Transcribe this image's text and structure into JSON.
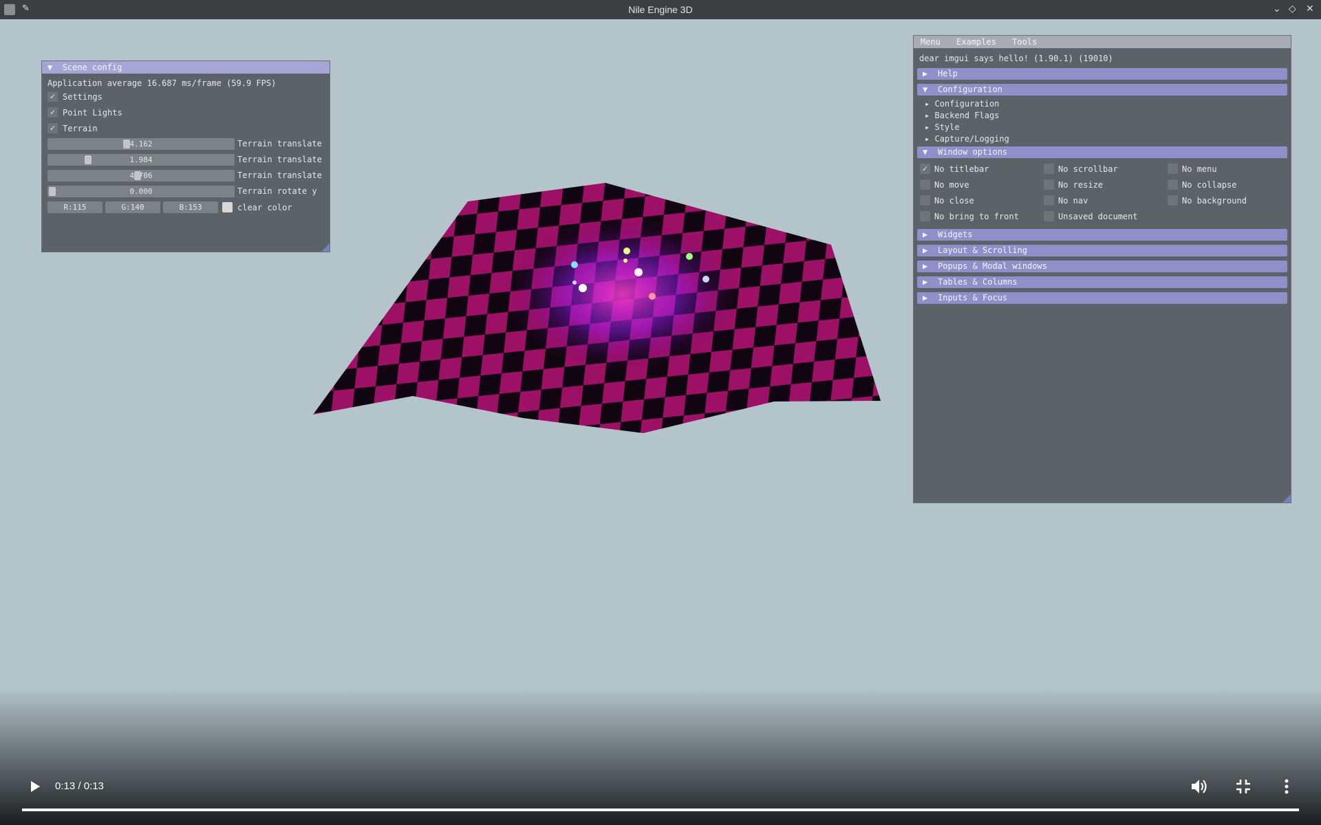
{
  "window": {
    "title": "Nile Engine 3D"
  },
  "scene_config": {
    "title": "Scene config",
    "fps_text": "Application average 16.687 ms/frame (59.9 FPS)",
    "checkboxes": [
      {
        "label": "Settings",
        "checked": true
      },
      {
        "label": "Point Lights",
        "checked": true
      },
      {
        "label": "Terrain",
        "checked": true
      }
    ],
    "sliders": [
      {
        "value": "4.162",
        "label": "Terrain translate x"
      },
      {
        "value": "1.984",
        "label": "Terrain translate y"
      },
      {
        "value": "4.706",
        "label": "Terrain translate z"
      },
      {
        "value": "0.000",
        "label": "Terrain rotate y"
      }
    ],
    "color": {
      "r": "R:115",
      "g": "G:140",
      "b": "B:153",
      "label": "clear color"
    }
  },
  "demo_window": {
    "menu": [
      "Menu",
      "Examples",
      "Tools"
    ],
    "hello_text": "dear imgui says hello! (1.90.1) (19010)",
    "headers": {
      "help": "Help",
      "configuration": "Configuration",
      "window_options": "Window options",
      "widgets": "Widgets",
      "layout": "Layout & Scrolling",
      "popups": "Popups & Modal windows",
      "tables": "Tables & Columns",
      "inputs": "Inputs & Focus"
    },
    "config_items": [
      "Configuration",
      "Backend Flags",
      "Style",
      "Capture/Logging"
    ],
    "window_options": [
      {
        "label": "No titlebar",
        "checked": true
      },
      {
        "label": "No scrollbar",
        "checked": false
      },
      {
        "label": "No menu",
        "checked": false
      },
      {
        "label": "No move",
        "checked": false
      },
      {
        "label": "No resize",
        "checked": false
      },
      {
        "label": "No collapse",
        "checked": false
      },
      {
        "label": "No close",
        "checked": false
      },
      {
        "label": "No nav",
        "checked": false
      },
      {
        "label": "No background",
        "checked": false
      },
      {
        "label": "No bring to front",
        "checked": false
      },
      {
        "label": "Unsaved document",
        "checked": false
      }
    ]
  },
  "player": {
    "time": "0:13 / 0:13",
    "progress": 1.0,
    "icons": {
      "play": "play-icon",
      "volume": "volume-icon",
      "exit_fullscreen": "exit-fullscreen-icon",
      "more": "more-options-icon"
    }
  },
  "colors": {
    "background": "#b4c4cb",
    "accent": "#a5a6d6",
    "terrain": "#a0105a"
  }
}
